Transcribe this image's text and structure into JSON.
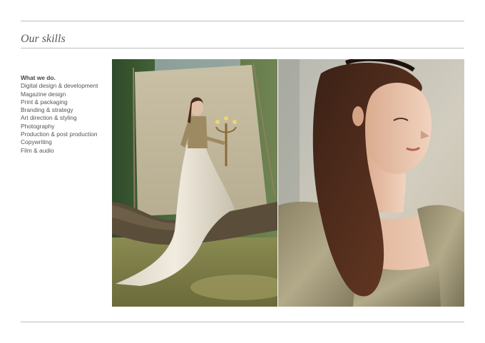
{
  "page": {
    "title": "Our skills"
  },
  "skills": {
    "heading": "What we do.",
    "items": [
      "Digital design & development",
      "Magazine design",
      "Print & packaging",
      "Branding & strategy",
      "Art direction & styling",
      "Photography",
      "Production & post production",
      "Copywriting",
      "Film & audio"
    ]
  },
  "colors": {
    "rule": "#bdbdbd",
    "title_text": "#5a5a5a",
    "body_text": "#555555"
  }
}
